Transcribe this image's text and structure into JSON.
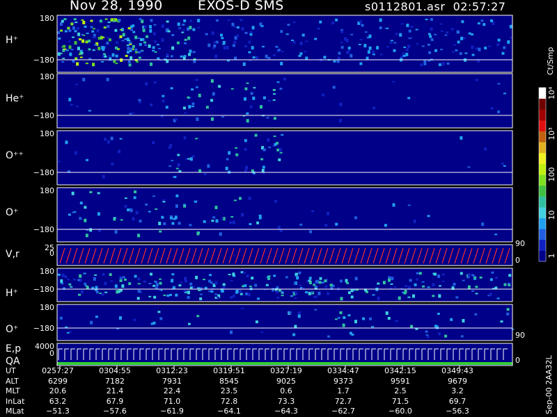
{
  "header": {
    "date": "Nov 28, 1990",
    "instrument": "EXOS-D SMS",
    "file_time": "s0112801.asr  02:57:27"
  },
  "colorbar": {
    "unit_label": "Ct/Smp",
    "tick_labels": [
      "1",
      "10",
      "100",
      "10³",
      "10⁴"
    ],
    "colors": [
      "#000088",
      "#1020c0",
      "#2060e0",
      "#20a0f0",
      "#40d0e0",
      "#30c0a0",
      "#40c040",
      "#80e020",
      "#c0f010",
      "#f0f020",
      "#e0b020",
      "#c06010",
      "#e01010",
      "#a00000",
      "#700000",
      "#ffffff"
    ]
  },
  "panels": [
    {
      "label": "H⁺",
      "y_top": "180",
      "y_bottom": "−180"
    },
    {
      "label": "He⁺",
      "y_top": "180",
      "y_bottom": "−180"
    },
    {
      "label": "O⁺⁺",
      "y_top": "180",
      "y_bottom": "−180"
    },
    {
      "label": "O⁺",
      "y_top": "180",
      "y_bottom": "−180"
    },
    {
      "label": "V,r",
      "y_top": "25",
      "y_bottom": "0",
      "right_top": "90",
      "right_bottom": "0"
    },
    {
      "label": "H⁺",
      "y_top": "180",
      "y_bottom": "−180"
    },
    {
      "label": "O⁺",
      "y_top": "180",
      "y_bottom": "−180",
      "right_bottom": "90"
    },
    {
      "label": "E,p",
      "label2": "QA",
      "y_top": "4000",
      "y_bottom": "0",
      "right_bottom": "0"
    }
  ],
  "ephemeris": {
    "rows": [
      {
        "label": "UT",
        "values": [
          "0257:27",
          "0304:55",
          "0312:23",
          "0319:51",
          "0327:19",
          "0334:47",
          "0342:15",
          "0349:43"
        ]
      },
      {
        "label": "ALT",
        "values": [
          "6299",
          "7182",
          "7931",
          "8545",
          "9025",
          "9373",
          "9591",
          "9679"
        ]
      },
      {
        "label": "MLT",
        "values": [
          "20.6",
          "21.4",
          "22.4",
          "23.5",
          "0.6",
          "1.7",
          "2.5",
          "3.2"
        ]
      },
      {
        "label": "InLat",
        "values": [
          "63.2",
          "67.9",
          "71.0",
          "72.8",
          "73.3",
          "72.7",
          "71.5",
          "69.7"
        ]
      },
      {
        "label": "MLat",
        "values": [
          "−51.3",
          "−57.6",
          "−61.9",
          "−64.1",
          "−64.3",
          "−62.7",
          "−60.0",
          "−56.3"
        ]
      }
    ]
  },
  "footer_id": "Sep-00 2AA32L",
  "chart_data": {
    "type": "heatmap",
    "title": "Nov 28, 1990   EXOS-D SMS",
    "x": [
      "0257:27",
      "0304:55",
      "0312:23",
      "0319:51",
      "0327:19",
      "0334:47",
      "0342:15",
      "0349:43"
    ],
    "colorbar_ticks": [
      1,
      10,
      100,
      1000,
      10000
    ],
    "colorbar_scale": "log",
    "colorbar_label": "Ct/Smp",
    "series": [
      {
        "name": "H⁺",
        "ylim": [
          -180,
          180
        ]
      },
      {
        "name": "He⁺",
        "ylim": [
          -180,
          180
        ]
      },
      {
        "name": "O⁺⁺",
        "ylim": [
          -180,
          180
        ]
      },
      {
        "name": "O⁺",
        "ylim": [
          -180,
          180
        ]
      },
      {
        "name": "V,r",
        "ylim": [
          0,
          25
        ]
      },
      {
        "name": "H⁺",
        "ylim": [
          -180,
          180
        ]
      },
      {
        "name": "O⁺",
        "ylim": [
          -180,
          180
        ]
      },
      {
        "name": "E,p",
        "ylim": [
          0,
          4000
        ]
      }
    ]
  }
}
